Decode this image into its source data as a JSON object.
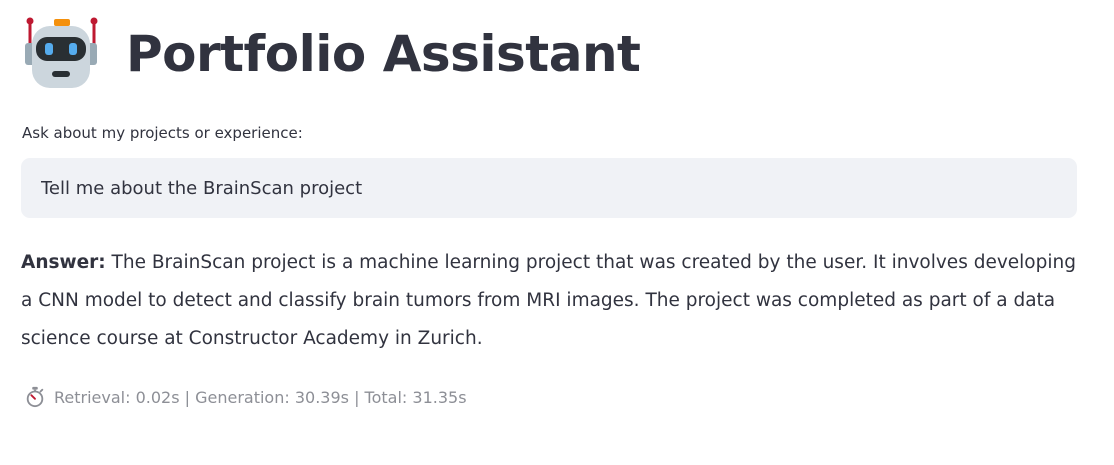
{
  "header": {
    "title": "Portfolio Assistant",
    "icon": "robot-icon"
  },
  "query": {
    "label": "Ask about my projects or experience:",
    "value": "Tell me about the BrainScan project"
  },
  "answer": {
    "prefix": "Answer:",
    "text": " The BrainScan project is a machine learning project that was created by the user. It involves developing a CNN model to detect and classify brain tumors from MRI images. The project was completed as part of a data science course at Constructor Academy in Zurich."
  },
  "timing": {
    "icon": "stopwatch-icon",
    "text": "Retrieval: 0.02s | Generation: 30.39s | Total: 31.35s"
  },
  "colors": {
    "text": "#31333f",
    "input_bg": "#f0f2f6",
    "muted": "#8d8f96",
    "robot_head": "#ccd6dd",
    "robot_accent": "#be1931",
    "robot_eyes": "#55acee"
  }
}
